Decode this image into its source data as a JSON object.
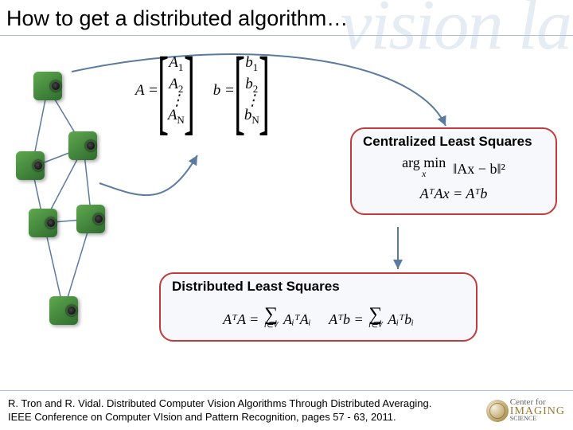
{
  "watermark": "vision lab",
  "title": "How to get a distributed algorithm…",
  "matrix": {
    "A_label": "A =",
    "A_rows": [
      "A₁",
      "A₂",
      "⋮",
      "A_N"
    ],
    "b_label": "b =",
    "b_rows": [
      "b₁",
      "b₂",
      "⋮",
      "b_N"
    ]
  },
  "cls": {
    "title": "Centralized Least Squares",
    "line1_pre": "arg min",
    "line1_sub": "x",
    "line1_expr": "‖Ax − b‖²",
    "line2": "AᵀAx = Aᵀb"
  },
  "dls": {
    "title": "Distributed Least Squares",
    "lhs1": "AᵀA =",
    "sum_lim": "i∈V",
    "term1": "AᵢᵀAᵢ",
    "sep": "   ",
    "lhs2": "Aᵀb =",
    "term2": "Aᵢᵀbᵢ"
  },
  "citation": {
    "line1": "R. Tron and R. Vidal. Distributed Computer Vision Algorithms Through Distributed Averaging.",
    "line2": "IEEE Conference on Computer VIsion and Pattern Recognition, pages 57 - 63, 2011."
  },
  "logo": {
    "prefix": "Center for",
    "main": "IMAGING",
    "suffix": "SCIENCE"
  }
}
